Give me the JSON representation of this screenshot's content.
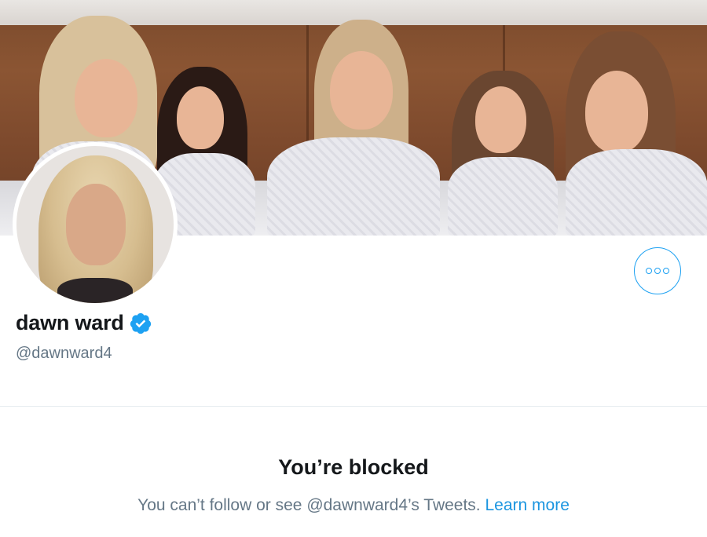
{
  "profile": {
    "display_name": "dawn ward",
    "handle": "@dawnward4",
    "verified": true,
    "banner_image": "family-photo-banner",
    "avatar_image": "profile-photo"
  },
  "actions": {
    "more_icon": "more-options-icon"
  },
  "blocked": {
    "title": "You’re blocked",
    "description": "You can’t follow or see @dawnward4’s Tweets.",
    "learn_more": "Learn more"
  },
  "colors": {
    "accent": "#1da1f2",
    "link": "#1b95e0",
    "primary_text": "#14171a",
    "secondary_text": "#657786",
    "divider": "#e6ecf0"
  }
}
